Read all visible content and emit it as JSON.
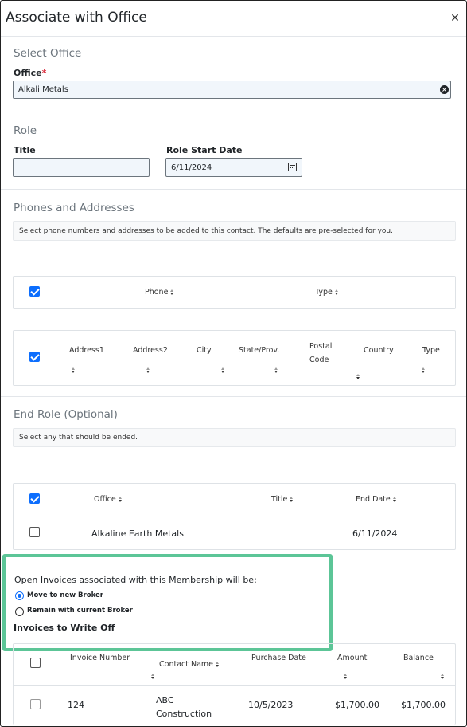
{
  "dialog": {
    "title": "Associate with Office",
    "close_glyph": "✕"
  },
  "select_office": {
    "section_title": "Select Office",
    "office_label": "Office",
    "required_mark": "*",
    "office_value": "Alkali Metals"
  },
  "role": {
    "section_title": "Role",
    "title_label": "Title",
    "title_value": "",
    "start_date_label": "Role Start Date",
    "start_date_value": "6/11/2024"
  },
  "phones_addresses": {
    "section_title": "Phones and Addresses",
    "info_text": "Select phone numbers and addresses to be added to this contact. The defaults are pre-selected for you.",
    "phone_table": {
      "headers": [
        "Phone",
        "Type"
      ],
      "select_all_checked": true
    },
    "address_table": {
      "headers": [
        "Address1",
        "Address2",
        "City",
        "State/Prov.",
        "Postal Code",
        "Country",
        "Type"
      ],
      "postal_lines": [
        "Postal",
        "Code"
      ],
      "select_all_checked": true
    }
  },
  "end_role": {
    "section_title": "End Role (Optional)",
    "info_text": "Select any that should be ended.",
    "table": {
      "headers": [
        "Office",
        "Title",
        "End Date"
      ],
      "select_all_checked": true,
      "rows": [
        {
          "checked": false,
          "office": "Alkaline Earth Metals",
          "title": "",
          "end_date": "6/11/2024"
        }
      ]
    }
  },
  "invoices": {
    "prompt": "Open Invoices associated with this Membership will be:",
    "options": [
      {
        "label": "Move to new Broker",
        "selected": true
      },
      {
        "label": "Remain with current Broker",
        "selected": false
      }
    ],
    "write_off_title": "Invoices to Write Off",
    "table": {
      "headers": [
        "Invoice Number",
        "Contact Name",
        "Purchase Date",
        "Amount",
        "Balance"
      ],
      "rows": [
        {
          "checked": false,
          "invoice_number": "124",
          "contact_name_lines": [
            "ABC",
            "Construction"
          ],
          "purchase_date": "10/5/2023",
          "amount": "$1,700.00",
          "balance": "$1,700.00"
        }
      ]
    }
  },
  "colors": {
    "accent": "#0d6efd",
    "highlight_border": "#5cc597",
    "required": "#dc3545",
    "section_title": "#6c757d"
  }
}
